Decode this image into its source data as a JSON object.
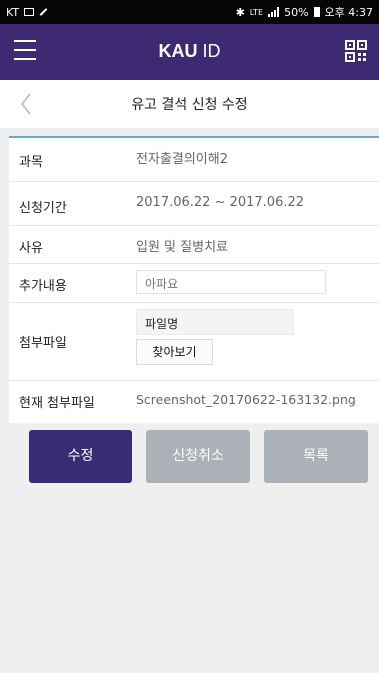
{
  "status_bar": {
    "carrier": "KT",
    "status_text": "50%",
    "clock": "오후 4:37",
    "lte": "LTE"
  },
  "app": {
    "title_bold": "KAU",
    "title_light": " ID"
  },
  "page": {
    "title": "유고 결석 신청 수정"
  },
  "form": {
    "rows": [
      {
        "label": "과목",
        "value": "전자출결의이해2"
      },
      {
        "label": "신청기간",
        "value": "2017.06.22 ~ 2017.06.22"
      },
      {
        "label": "사유",
        "value": "입원 및 질병치료"
      },
      {
        "label": "추가내용",
        "value": "아파요"
      },
      {
        "label": "첨부파일",
        "file_name": "파일명",
        "browse_label": "찾아보기"
      },
      {
        "label": "현재 첨부파일",
        "value": "Screenshot_20170622-163132.png"
      }
    ]
  },
  "buttons": {
    "edit": "수정",
    "cancel": "신청취소",
    "list": "목록"
  },
  "colors": {
    "header_bg": "#3d2a73",
    "primary_button": "#3a2b76",
    "disabled_button": "#abb1b7",
    "card_accent": "#6fa6d6"
  }
}
